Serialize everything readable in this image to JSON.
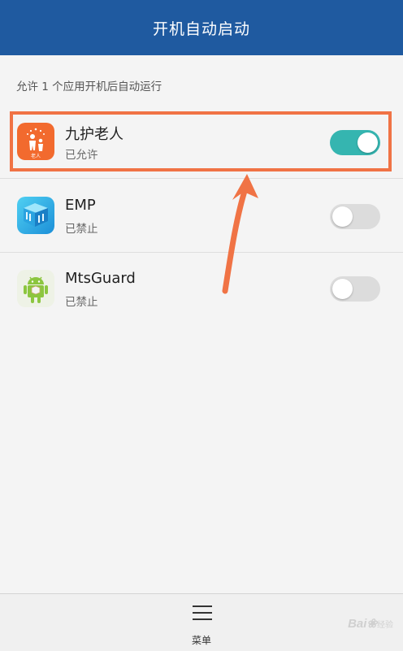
{
  "header": {
    "title": "开机自动启动"
  },
  "subtitle": "允许 1 个应用开机后自动运行",
  "apps": [
    {
      "name": "九护老人",
      "status": "已允许",
      "enabled": true,
      "icon": "elderly-care-app-icon"
    },
    {
      "name": "EMP",
      "status": "已禁止",
      "enabled": false,
      "icon": "emp-app-icon"
    },
    {
      "name": "MtsGuard",
      "status": "已禁止",
      "enabled": false,
      "icon": "android-robot-icon"
    }
  ],
  "bottom": {
    "menu_label": "菜单",
    "menu_icon": "hamburger-menu-icon"
  },
  "watermark": {
    "text": "Bai",
    "suffix": "经验"
  },
  "colors": {
    "header_bg": "#1f5aa0",
    "toggle_on": "#35b5b0",
    "toggle_off": "#dcdcdc",
    "annotation": "#f07345"
  }
}
